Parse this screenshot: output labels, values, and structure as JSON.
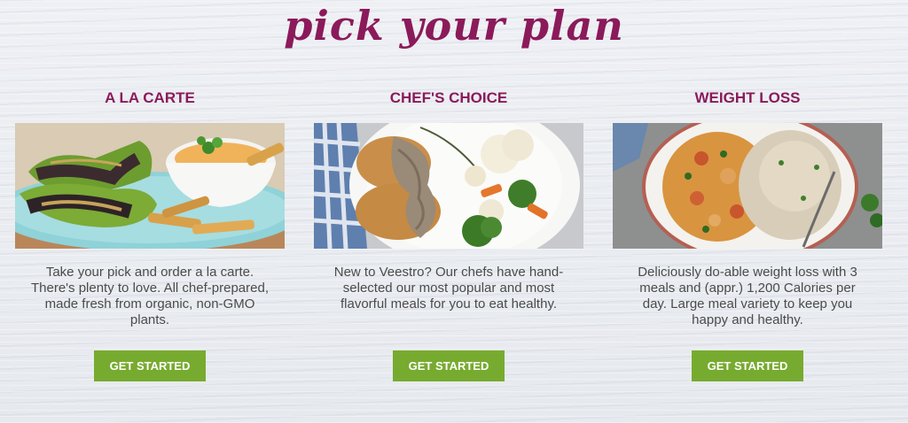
{
  "page": {
    "title": "pick your plan",
    "accent_color": "#8b1a5a",
    "button_color": "#77ab2f"
  },
  "plans": [
    {
      "title": "A LA CARTE",
      "image": "wrap-with-fries-photo",
      "description": "Take your pick and order a la carte. There's plenty to love. All chef-prepared, made fresh from organic, non-GMO plants.",
      "button_label": "GET STARTED"
    },
    {
      "title": "CHEF'S CHOICE",
      "image": "cutlet-with-gravy-and-vegetables-photo",
      "description": "New to Veestro? Our chefs have hand-selected our most popular and most flavorful meals for you to eat healthy.",
      "button_label": "GET STARTED"
    },
    {
      "title": "WEIGHT LOSS",
      "image": "curry-with-rice-photo",
      "description": "Deliciously do-able weight loss with 3 meals and (appr.) 1,200 Calories per day. Large meal variety to keep you happy and healthy.",
      "button_label": "GET STARTED"
    }
  ]
}
